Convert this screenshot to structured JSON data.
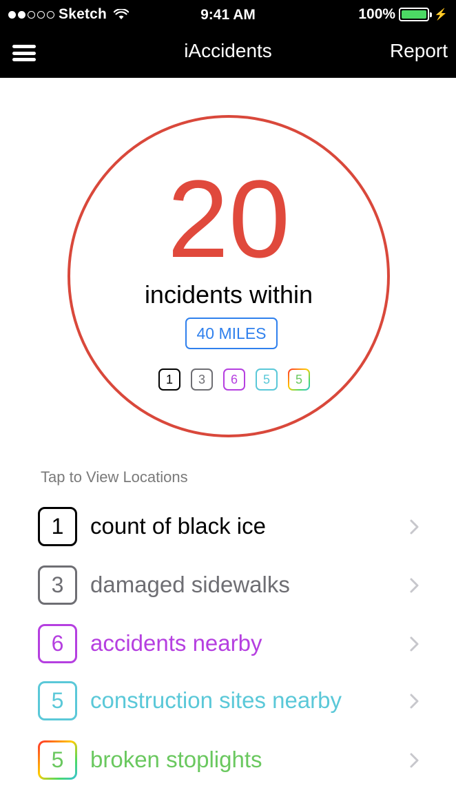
{
  "status_bar": {
    "carrier": "Sketch",
    "time": "9:41 AM",
    "battery_percent": "100%",
    "signal_bars_filled": 2,
    "signal_bars_total": 5,
    "battery_color": "#4cd964"
  },
  "nav": {
    "title": "iAccidents",
    "menu_icon": "hamburger-menu-icon",
    "report_label": "Report"
  },
  "summary": {
    "total": "20",
    "subtitle": "incidents within",
    "radius_label": "40 MILES",
    "accent_color": "#e0493c",
    "radius_color": "#2f80ed"
  },
  "mini_badges": [
    {
      "count": "1",
      "color": "#000000"
    },
    {
      "count": "3",
      "color": "#6e6e73"
    },
    {
      "count": "6",
      "color": "#b53fe0"
    },
    {
      "count": "5",
      "color": "#5ac8d8"
    },
    {
      "count": "5",
      "color": "#6ac85f",
      "gradient": true
    }
  ],
  "list": {
    "header": "Tap to View Locations",
    "items": [
      {
        "count": "1",
        "label": "count of black ice",
        "color": "#000000"
      },
      {
        "count": "3",
        "label": "damaged sidewalks",
        "color": "#6e6e73"
      },
      {
        "count": "6",
        "label": "accidents nearby",
        "color": "#b53fe0"
      },
      {
        "count": "5",
        "label": "construction sites nearby",
        "color": "#5ac8d8"
      },
      {
        "count": "5",
        "label": "broken stoplights",
        "color": "#6ac85f",
        "gradient": true
      }
    ]
  }
}
